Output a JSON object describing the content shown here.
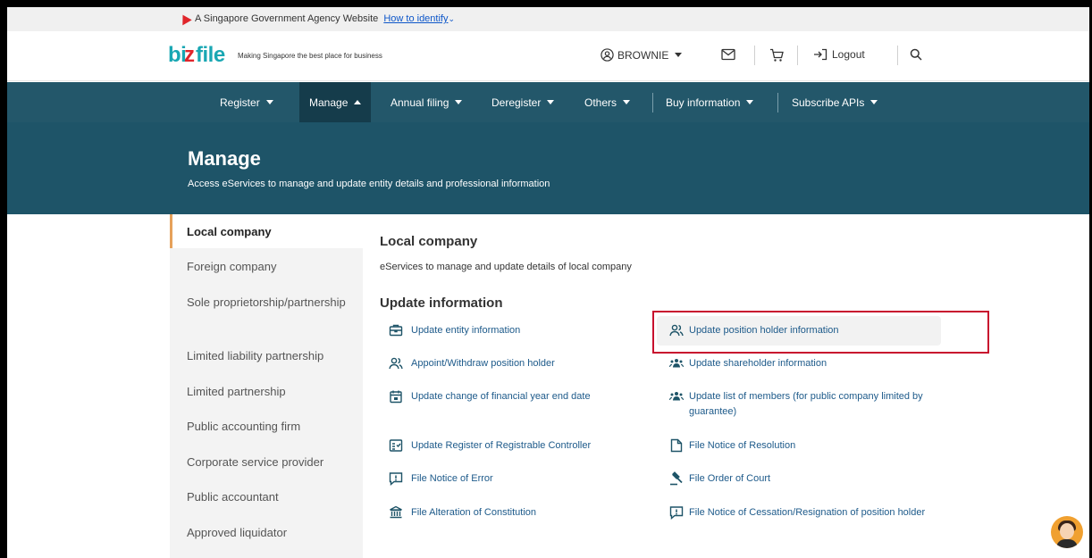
{
  "gov_banner": {
    "text": "A Singapore Government Agency Website",
    "link": "How to identify"
  },
  "header": {
    "logo": "bizfile",
    "tagline": "Making Singapore the best place for business",
    "user": "BROWNIE",
    "logout": "Logout"
  },
  "nav": {
    "items": [
      {
        "label": "Register"
      },
      {
        "label": "Manage"
      },
      {
        "label": "Annual filing"
      },
      {
        "label": "Deregister"
      },
      {
        "label": "Others"
      },
      {
        "label": "Buy information"
      },
      {
        "label": "Subscribe APIs"
      }
    ]
  },
  "hero": {
    "title": "Manage",
    "subtitle": "Access eServices to manage and update entity details and professional information"
  },
  "sidebar": {
    "items": [
      {
        "label": "Local company"
      },
      {
        "label": "Foreign company"
      },
      {
        "label": "Sole proprietorship/partnership"
      },
      {
        "label": "Limited liability partnership"
      },
      {
        "label": "Limited partnership"
      },
      {
        "label": "Public accounting firm"
      },
      {
        "label": "Corporate service provider"
      },
      {
        "label": "Public accountant"
      },
      {
        "label": "Approved liquidator"
      }
    ]
  },
  "main": {
    "title": "Local company",
    "subtitle": "eServices to manage and update details of local company",
    "section_title": "Update information",
    "links": [
      {
        "label": "Update entity information",
        "icon": "briefcase-icon"
      },
      {
        "label": "Update position holder information",
        "icon": "people-icon"
      },
      {
        "label": "Appoint/Withdraw position holder",
        "icon": "people-icon"
      },
      {
        "label": "Update shareholder information",
        "icon": "group-icon"
      },
      {
        "label": "Update change of financial year end date",
        "icon": "calendar-icon"
      },
      {
        "label": "Update list of members (for public company limited by guarantee)",
        "icon": "group-icon"
      },
      {
        "label": "Update Register of Registrable Controller",
        "icon": "register-icon"
      },
      {
        "label": "File Notice of Resolution",
        "icon": "document-icon"
      },
      {
        "label": "File Notice of Error",
        "icon": "alert-message-icon"
      },
      {
        "label": "File Order of Court",
        "icon": "gavel-icon"
      },
      {
        "label": "File Alteration of Constitution",
        "icon": "institution-icon"
      },
      {
        "label": "File Notice of Cessation/Resignation of position holder",
        "icon": "alert-message-icon"
      }
    ]
  },
  "colors": {
    "nav_bg": "#23576a",
    "nav_active_bg": "#153c4b",
    "hero_bg": "#1e5468",
    "highlight_border": "#c8102e",
    "sidebar_accent": "#e6a15a"
  }
}
